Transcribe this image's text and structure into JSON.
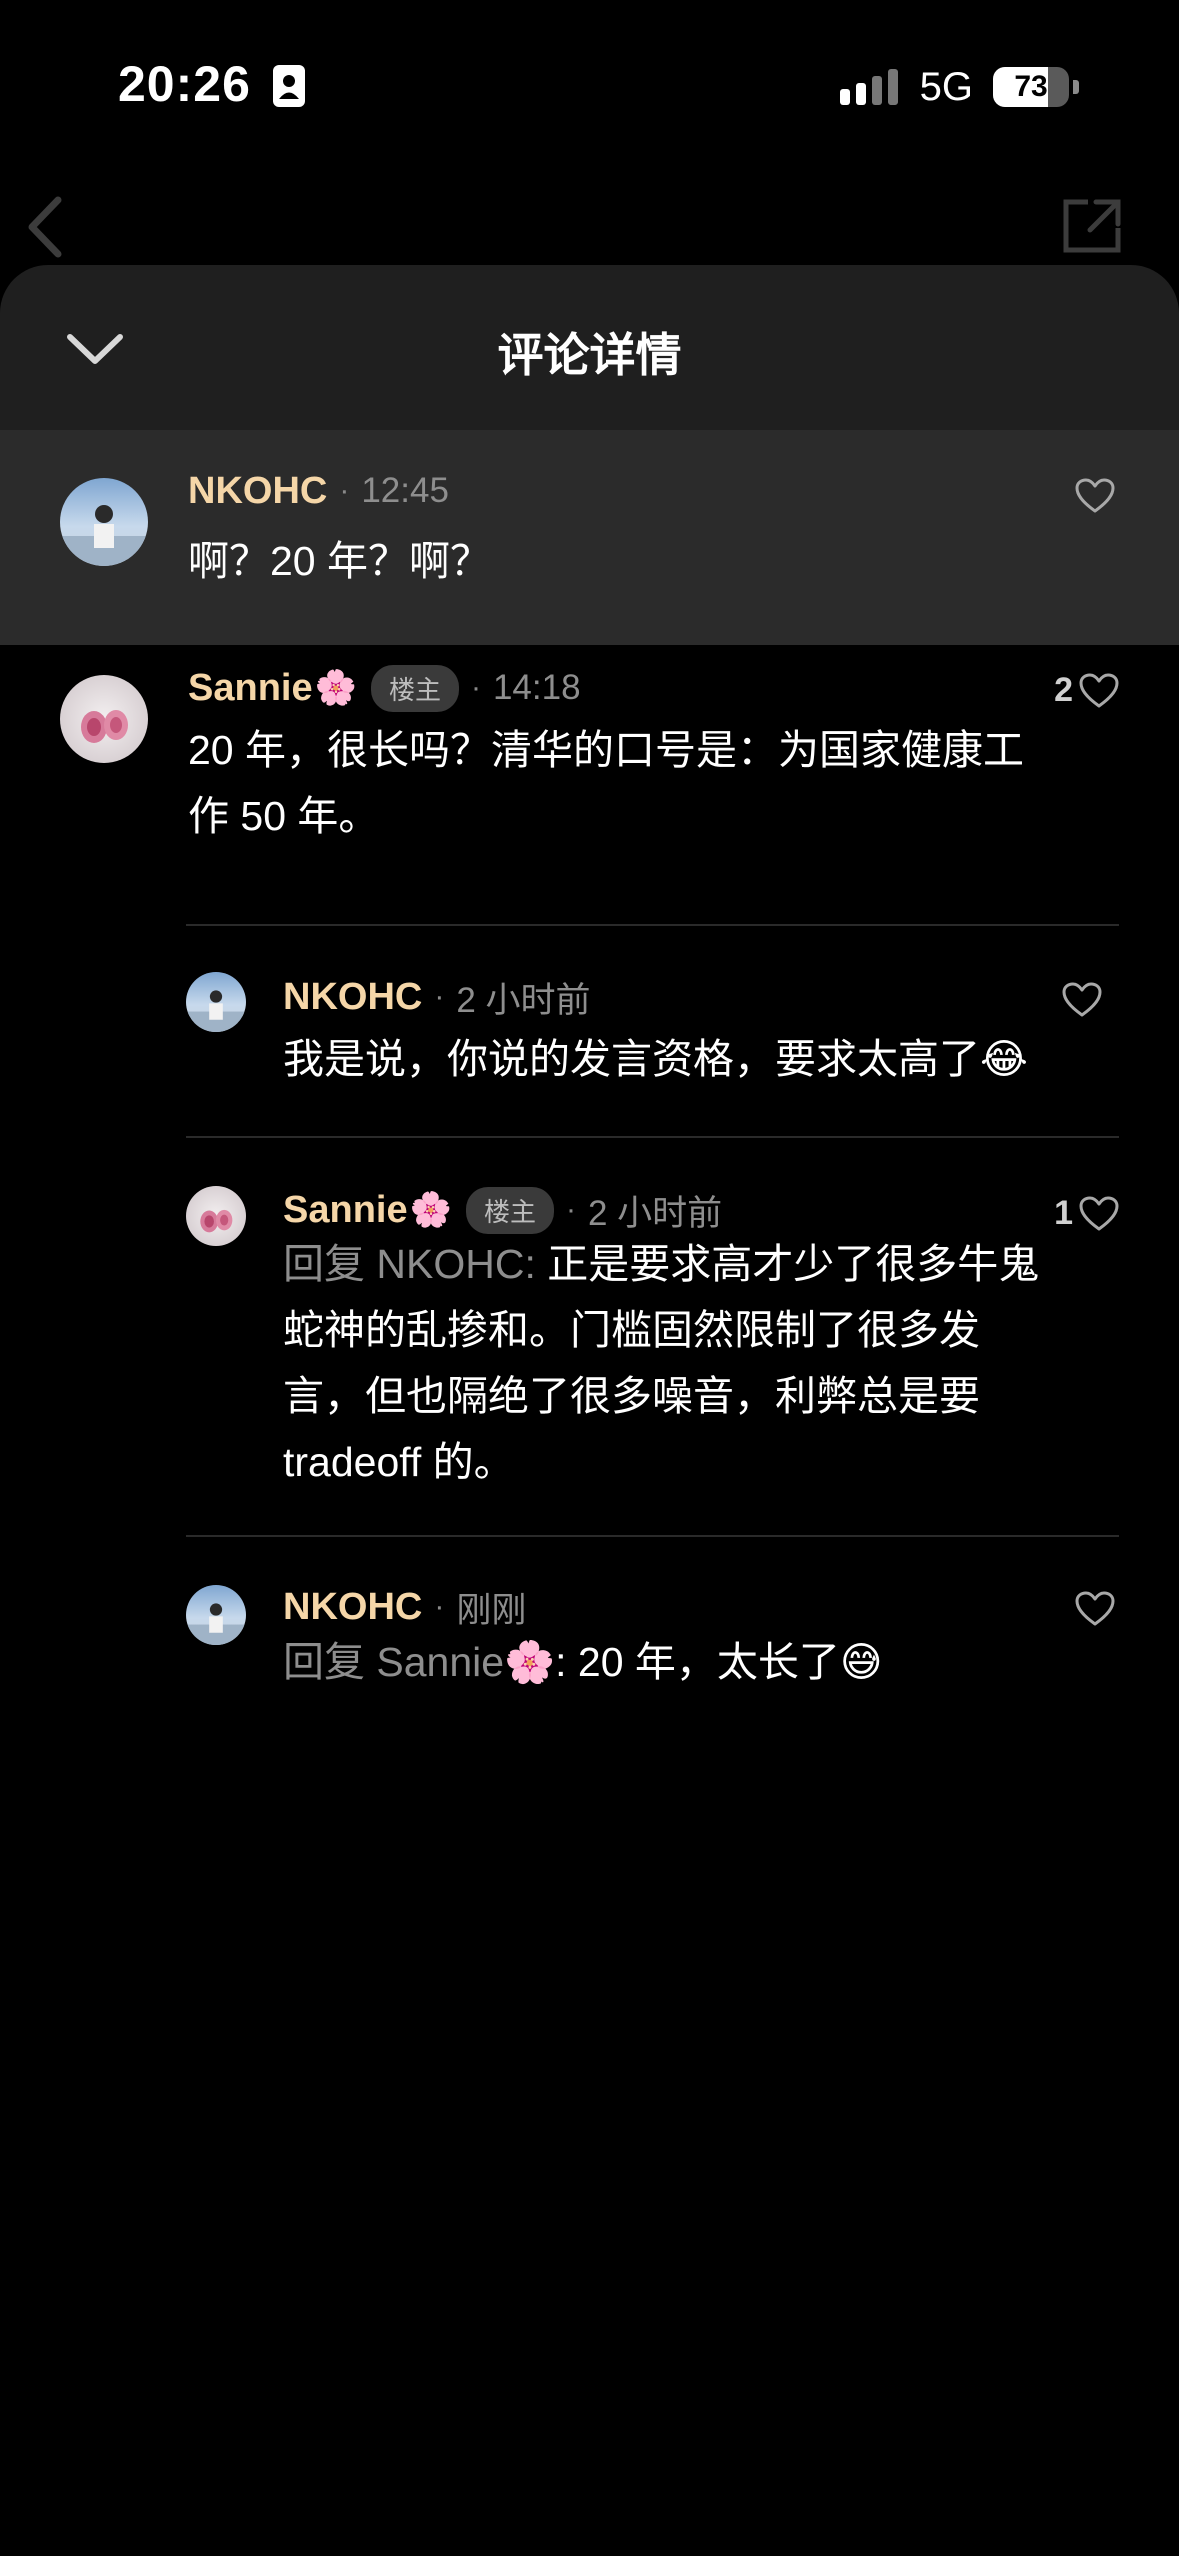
{
  "status_bar": {
    "time": "20:26",
    "network": "5G",
    "battery": "73",
    "battery_level": 0.73
  },
  "sheet": {
    "title": "评论详情"
  },
  "main_comment": {
    "author": "NKOHC",
    "time": "12:45",
    "text": "啊？20 年？啊？"
  },
  "replies": [
    {
      "author": "Sannie",
      "author_emoji": "🌸",
      "badge": "楼主",
      "time": "14:18",
      "likes": "2",
      "line1": "20 年，很长吗？清华的口号是：为国家健康工",
      "line2": "作 50 年。"
    },
    {
      "author": "NKOHC",
      "time": "2 小时前",
      "likes": "",
      "text": "我是说，你说的发言资格，要求太高了",
      "emoji": "😂"
    },
    {
      "author": "Sannie",
      "author_emoji": "🌸",
      "badge": "楼主",
      "time": "2 小时前",
      "likes": "1",
      "prefix": "回复 NKOHC: ",
      "line1": "正是要求高才少了很多牛鬼",
      "line2": "蛇神的乱掺和。门槛固然限制了很多发",
      "line3": "言，但也隔绝了很多噪音，利弊总是要",
      "line4": "tradeoff 的。"
    },
    {
      "author": "NKOHC",
      "time": "刚刚",
      "likes": "",
      "prefix": "回复 Sannie",
      "prefix_emoji": "🌸",
      "prefix_colon": ": ",
      "text": "20 年，太长了",
      "emoji": "😅"
    }
  ]
}
